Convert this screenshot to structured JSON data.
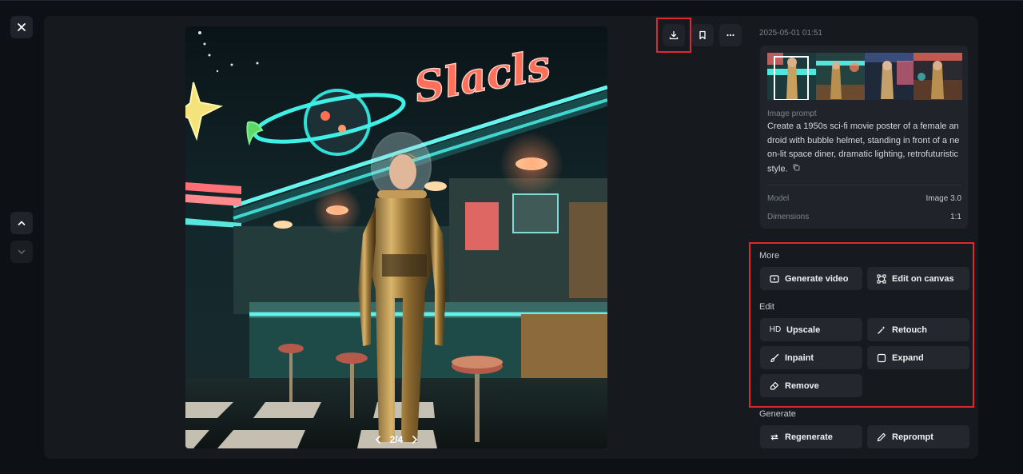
{
  "timestamp": "2025-05-01 01:51",
  "pager": {
    "text": "2/4"
  },
  "info": {
    "prompt_title": "Image prompt",
    "prompt_text": "Create a 1950s sci-fi movie poster of a female android with bubble helmet, standing in front of a neon-lit space diner, dramatic lighting, retrofuturistic style.",
    "model_label": "Model",
    "model_value": "Image 3.0",
    "dimensions_label": "Dimensions",
    "dimensions_value": "1:1"
  },
  "sections": {
    "more": "More",
    "edit": "Edit",
    "generate": "Generate"
  },
  "buttons": {
    "generate_video": "Generate video",
    "edit_on_canvas": "Edit on canvas",
    "upscale_prefix": "HD",
    "upscale": "Upscale",
    "retouch": "Retouch",
    "inpaint": "Inpaint",
    "expand": "Expand",
    "remove": "Remove",
    "regenerate": "Regenerate",
    "reprompt": "Reprompt"
  },
  "scene_sign_text": "Slacls",
  "icons": {
    "close": "close-icon",
    "up": "chevron-up-icon",
    "down": "chevron-down-icon",
    "download": "download-icon",
    "bookmark": "bookmark-icon",
    "more": "more-horizontal-icon",
    "prev": "chevron-left-icon",
    "next": "chevron-right-icon"
  },
  "colors": {
    "highlight": "#e0262f",
    "panel": "#161a1f",
    "button": "#24282e"
  }
}
